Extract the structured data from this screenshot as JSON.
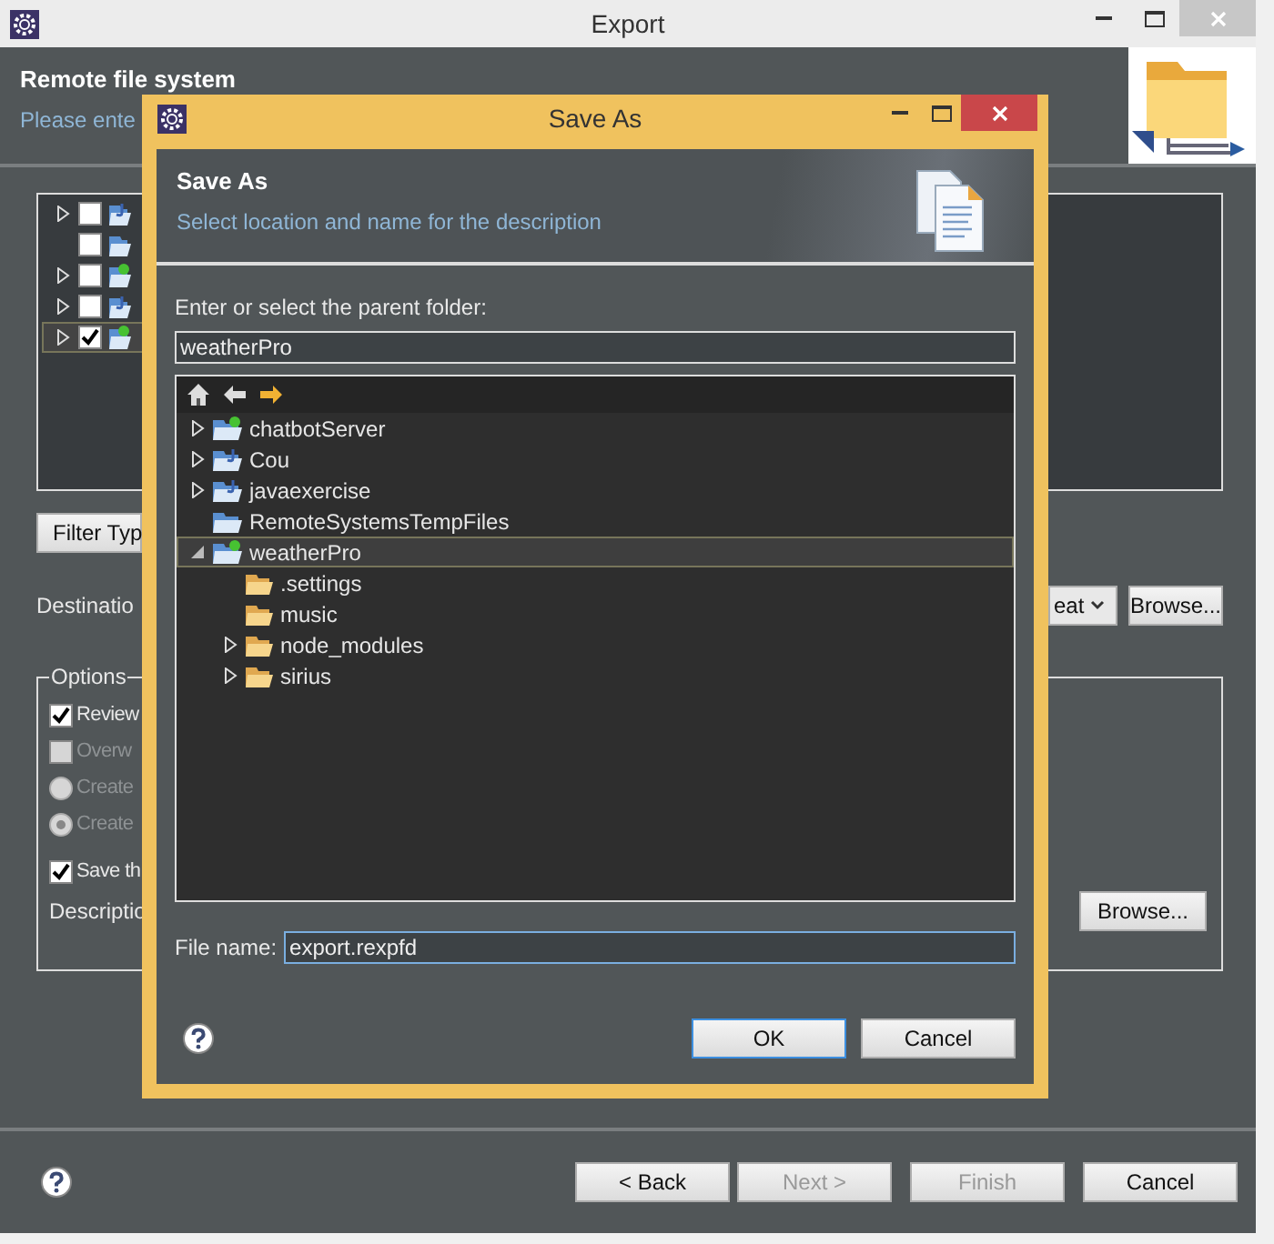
{
  "export_window": {
    "title": "Export",
    "header": {
      "title": "Remote file system",
      "subtitle": "Please ente"
    },
    "project_tree": [
      {
        "expandable": true,
        "checked": false,
        "selected": false,
        "kind": "java_project"
      },
      {
        "expandable": false,
        "checked": false,
        "selected": false,
        "kind": "project"
      },
      {
        "expandable": true,
        "checked": false,
        "selected": false,
        "kind": "web_project"
      },
      {
        "expandable": true,
        "checked": false,
        "selected": false,
        "kind": "java_project"
      },
      {
        "expandable": true,
        "checked": true,
        "selected": true,
        "kind": "web_project"
      }
    ],
    "filter_button": "Filter Typ",
    "destination": {
      "label": "Destinatio",
      "combo_value": "eat",
      "browse": "Browse..."
    },
    "options": {
      "legend": "Options",
      "items": [
        {
          "kind": "checkbox",
          "label": "Review",
          "checked": true,
          "disabled": false
        },
        {
          "kind": "checkbox",
          "label": "Overw",
          "checked": false,
          "disabled": true
        },
        {
          "kind": "radio",
          "label": "Create",
          "selected": false,
          "disabled": true
        },
        {
          "kind": "radio",
          "label": "Create",
          "selected": true,
          "disabled": true
        },
        {
          "kind": "checkbox",
          "label": "Save th",
          "checked": true,
          "disabled": false
        }
      ],
      "description_label": "Descriptio",
      "browse": "Browse..."
    },
    "buttons": [
      {
        "label": "< Back",
        "disabled": false
      },
      {
        "label": "Next >",
        "disabled": true
      },
      {
        "label": "Finish",
        "disabled": true
      },
      {
        "label": "Cancel",
        "disabled": false
      }
    ]
  },
  "save_as_dialog": {
    "title": "Save As",
    "header": {
      "title": "Save As",
      "subtitle": "Select location and name for the description"
    },
    "folder_label": "Enter or select the parent folder:",
    "folder_value": "weatherPro",
    "tree": [
      {
        "label": "chatbotServer",
        "kind": "web_project",
        "expandable": true,
        "expanded": false,
        "selected": false
      },
      {
        "label": "Cou",
        "kind": "java_project",
        "expandable": true,
        "expanded": false,
        "selected": false
      },
      {
        "label": "javaexercise",
        "kind": "java_project",
        "expandable": true,
        "expanded": false,
        "selected": false
      },
      {
        "label": "RemoteSystemsTempFiles",
        "kind": "project",
        "expandable": false,
        "selected": false
      },
      {
        "label": "weatherPro",
        "kind": "web_project",
        "expandable": true,
        "expanded": true,
        "selected": true,
        "children": [
          {
            "label": ".settings",
            "kind": "folder",
            "expandable": false,
            "selected": false
          },
          {
            "label": "music",
            "kind": "folder",
            "expandable": false,
            "selected": false
          },
          {
            "label": "node_modules",
            "kind": "folder",
            "expandable": true,
            "expanded": false,
            "selected": false
          },
          {
            "label": "sirius",
            "kind": "folder",
            "expandable": true,
            "expanded": false,
            "selected": false
          }
        ]
      }
    ],
    "file_name_label": "File name:",
    "file_name": "export.rexpfd",
    "buttons": [
      {
        "label": "OK",
        "default": true
      },
      {
        "label": "Cancel",
        "default": false
      }
    ]
  }
}
